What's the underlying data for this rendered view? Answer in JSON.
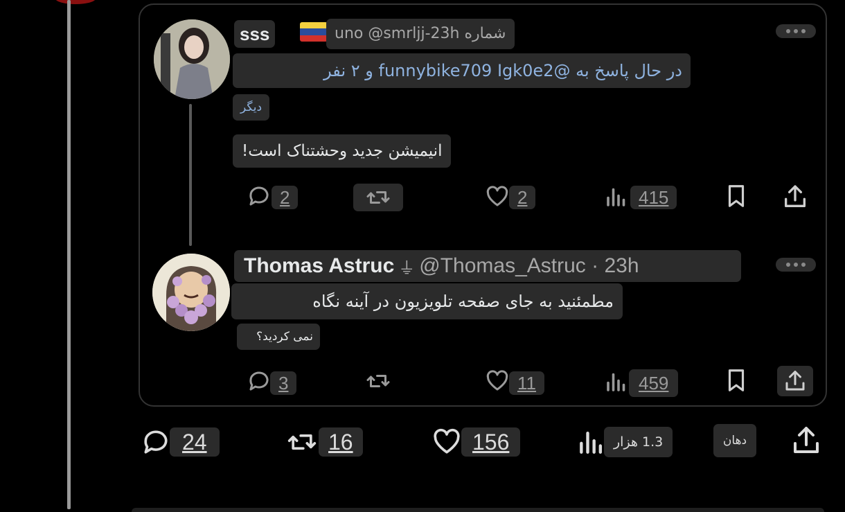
{
  "tweet1": {
    "name": "sss",
    "handle_time": "uno @smrljj-23h شماره",
    "reply_line": "در حال پاسخ به @funnybike709 Igk0e2 و ۲ نفر",
    "reply_more": "دیگر",
    "text": "انیمیشن جدید وحشتناک است!",
    "stats": {
      "replies": "2",
      "likes": "2",
      "views": "415"
    }
  },
  "tweet2": {
    "name": "Thomas Astruc",
    "handle_time": "@Thomas_Astruc · 23h",
    "text_line1": "مطمئنید به جای صفحه تلویزیون در آینه نگاه",
    "text_line2": "نمی کردید؟",
    "stats": {
      "replies": "3",
      "likes": "11",
      "views": "459"
    }
  },
  "main_stats": {
    "replies": "24",
    "retweets": "16",
    "likes": "156",
    "views": "1.3 هزار",
    "bookmark_label": "دهان"
  },
  "colors": {
    "background": "#000000",
    "text": "#e7e9ea",
    "link": "#8fb3e0",
    "chip": "#2b2b2b"
  },
  "icons": [
    "more-icon",
    "reply-icon",
    "retweet-icon",
    "like-icon",
    "views-icon",
    "bookmark-icon",
    "share-icon",
    "venezuela-flag-icon",
    "mute-icon"
  ]
}
